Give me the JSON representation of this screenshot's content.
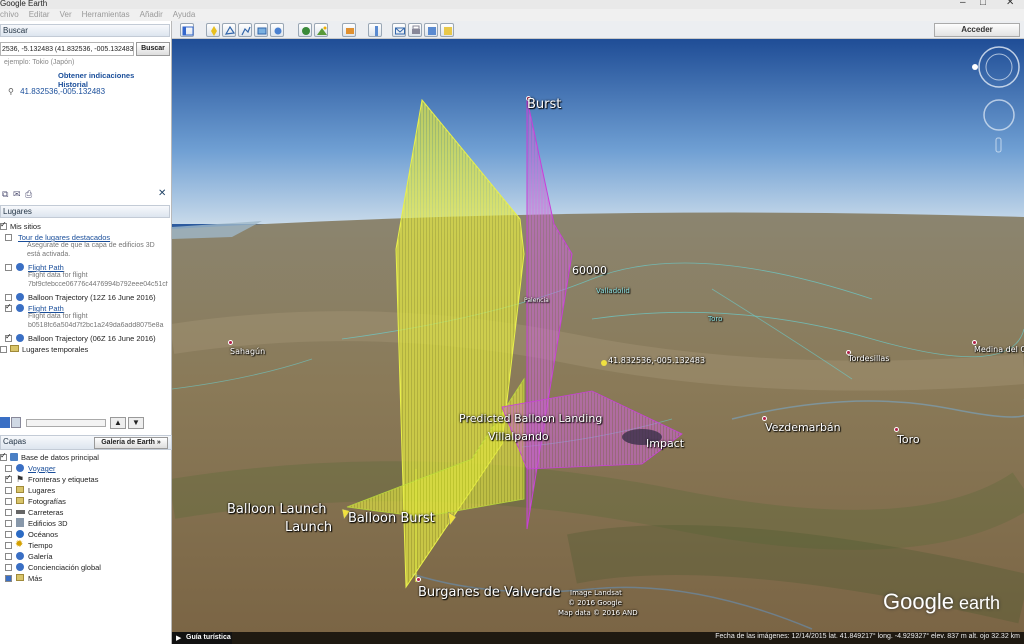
{
  "window": {
    "title": "Google Earth"
  },
  "menu": [
    "chivo",
    "Editar",
    "Ver",
    "Herramientas",
    "Añadir",
    "Ayuda"
  ],
  "toolbar": {
    "sign_in": "Acceder"
  },
  "search": {
    "header": "Buscar",
    "value": "2536, -5.132483 (41.832536, -005.132483)",
    "button": "Buscar",
    "hint": "ejemplo: Tokio (Japón)",
    "link_directions": "Obtener indicaciones",
    "link_history": "Historial",
    "result": "41.832536,-005.132483"
  },
  "places": {
    "header": "Lugares",
    "items": [
      {
        "label": "Mis sitios"
      },
      {
        "label": "Tour de lugares destacados",
        "desc1": "Asegúrate de que la capa de edificios 3D",
        "desc2": "está activada."
      },
      {
        "label": "Flight Path",
        "desc1": "Flight data for flight",
        "desc2": "7bf9cfebcce06776c4476994b792eee04c51cf"
      },
      {
        "label": "Balloon Trajectory (12Z 16 June 2016)"
      },
      {
        "label": "Flight Path",
        "desc1": "Flight data for flight",
        "desc2": "b0518fc6a504d7f2bc1a249da6add8075e8a"
      },
      {
        "label": "Balloon Trajectory (06Z 16 June 2016)"
      },
      {
        "label": "Lugares temporales"
      }
    ]
  },
  "layers": {
    "header": "Capas",
    "gallery_button": "Galería de Earth  »",
    "items": [
      "Base de datos principal",
      "Voyager",
      "Fronteras y etiquetas",
      "Lugares",
      "Fotografías",
      "Carreteras",
      "Edificios 3D",
      "Océanos",
      "Tiempo",
      "Galería",
      "Concienciación global",
      "Más"
    ]
  },
  "map": {
    "labels": {
      "burst": "Burst",
      "altitude": "60000",
      "coord_marker": "41.832536,-005.132483",
      "predicted_landing": "Predicted Balloon Landing",
      "villalpando": "Villalpando",
      "impact": "Impact",
      "balloon_launch": "Balloon Launch",
      "launch": "Launch",
      "balloon_burst": "Balloon Burst",
      "burganes": "Burganes de Valverde",
      "sahagun": "Sahagún",
      "palencia": "Palencia",
      "tordesillas": "Tordesillas",
      "medina": "Medina del C",
      "vezdemarban": "Vezdemarbán",
      "toro": "Toro",
      "valladolid": "Valladolid",
      "toro_small": "Toro",
      "credit1": "Image Landsat",
      "credit2": "© 2016 Google",
      "credit3": "Map data © 2016 AND"
    },
    "logo": {
      "google": "Google",
      "earth": " earth"
    }
  },
  "status": {
    "tour": "Guía turística",
    "text": "Fecha de las imágenes: 12/14/2015    lat.   41.849217°   long.   -4.929327°   elev.   837 m    alt. ojo  32.32 km"
  },
  "colors": {
    "yellow_curtain": "#e2e63a",
    "magenta_curtain": "#c050d0",
    "sky_top": "#2c5a9e",
    "ground": "#8a7a5a"
  }
}
